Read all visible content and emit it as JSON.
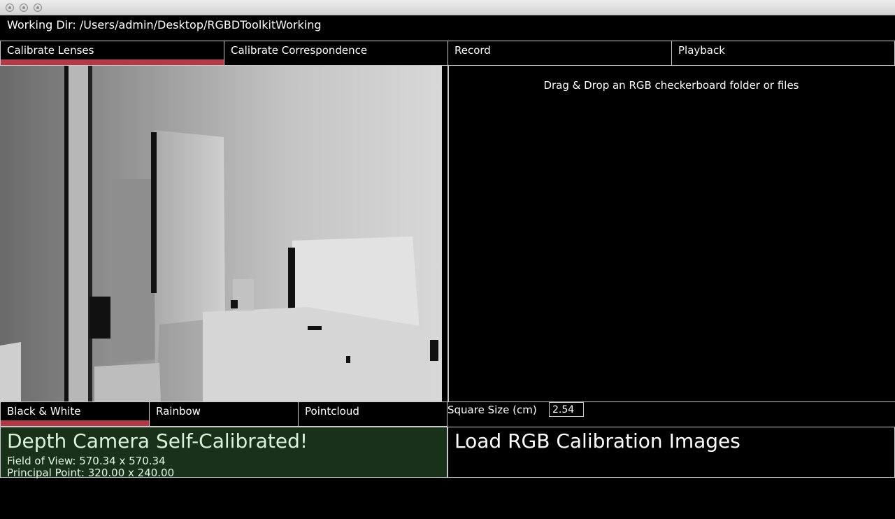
{
  "window": {
    "controls": [
      "close",
      "minimize",
      "zoom"
    ]
  },
  "header": {
    "working_dir": "Working Dir: /Users/admin/Desktop/RGBDToolkitWorking"
  },
  "tabs": [
    {
      "label": "Calibrate Lenses",
      "active": true
    },
    {
      "label": "Calibrate Correspondence",
      "active": false
    },
    {
      "label": "Record",
      "active": false
    },
    {
      "label": "Playback",
      "active": false
    }
  ],
  "view_modes": [
    {
      "label": "Black & White",
      "active": true
    },
    {
      "label": "Rainbow",
      "active": false
    },
    {
      "label": "Pointcloud",
      "active": false
    }
  ],
  "rgb_panel": {
    "drop_hint": "Drag & Drop an RGB checkerboard folder or files",
    "square_size_label": "Square Size (cm)",
    "square_size_value": "2.54",
    "load_title": "Load RGB Calibration Images"
  },
  "depth_status": {
    "title": "Depth Camera Self-Calibrated!",
    "fov": "Field of View: 570.34 x 570.34",
    "principal_point": "Principal Point: 320.00 x 240.00"
  },
  "colors": {
    "accent": "#b23a48",
    "status_bg": "#183118",
    "border": "#c8c8c8"
  }
}
